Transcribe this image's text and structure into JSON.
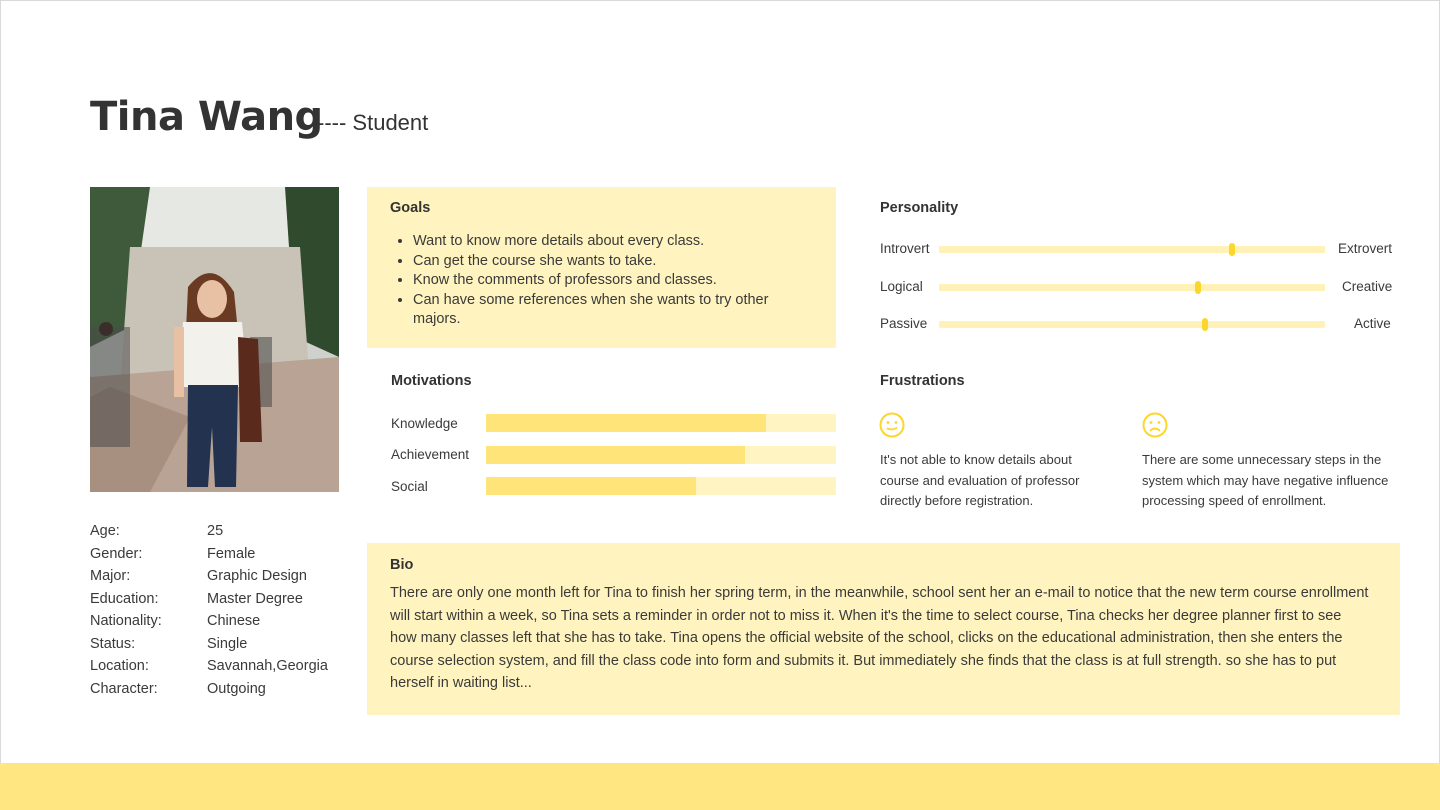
{
  "persona": {
    "name": "Tina Wang",
    "role": "---- Student"
  },
  "info": [
    {
      "label": "Age:",
      "value": "25"
    },
    {
      "label": "Gender:",
      "value": "Female"
    },
    {
      "label": "Major:",
      "value": "Graphic Design"
    },
    {
      "label": "Education:",
      "value": "Master Degree"
    },
    {
      "label": "Nationality:",
      "value": "Chinese"
    },
    {
      "label": "Status:",
      "value": "Single"
    },
    {
      "label": "Location:",
      "value": "Savannah,Georgia"
    },
    {
      "label": "Character:",
      "value": "Outgoing"
    }
  ],
  "goals": {
    "title": "Goals",
    "items": [
      "Want to know more details about every class.",
      "Can get the course she wants to take.",
      "Know the comments of professors and classes.",
      "Can have some references when she wants to try other majors."
    ]
  },
  "personality": {
    "title": "Personality",
    "scales": [
      {
        "left": "Introvert",
        "right": "Extrovert",
        "level": 0.76
      },
      {
        "left": "Logical",
        "right": "Creative",
        "level": 0.67
      },
      {
        "left": "Passive",
        "right": "Active",
        "level": 0.69
      }
    ]
  },
  "motivations": {
    "title": "Motivations",
    "items": [
      {
        "label": "Knowledge",
        "level": 0.8
      },
      {
        "label": "Achievement",
        "level": 0.74
      },
      {
        "label": "Social",
        "level": 0.6
      }
    ]
  },
  "frustrations": {
    "title": "Frustrations",
    "items": [
      {
        "icon": "neutral-face-icon",
        "text": "It's not able to know details about course and evaluation of professor directly before registration."
      },
      {
        "icon": "sad-face-icon",
        "text": "There are some unnecessary steps in the system which may have negative influence processing speed of enrollment."
      }
    ]
  },
  "bio": {
    "title": "Bio",
    "text": "There are only one month left for Tina to finish her spring term, in the meanwhile, school sent her an e-mail to notice that the new term course enrollment will start within a week, so Tina sets a reminder in order not to miss it. When it's the time to select course, Tina checks her degree planner first to see how many classes left that she has to take. Tina opens the official website of the school, clicks on the educational administration, then she enters the course selection system, and fill the class code into form and submits it. But immediately she finds that the class is at full strength. so she has to put herself in waiting list..."
  },
  "colors": {
    "accent": "#fcd62b",
    "panel": "#fff4bf",
    "bar": "#ffe47a",
    "band": "#ffe680"
  }
}
